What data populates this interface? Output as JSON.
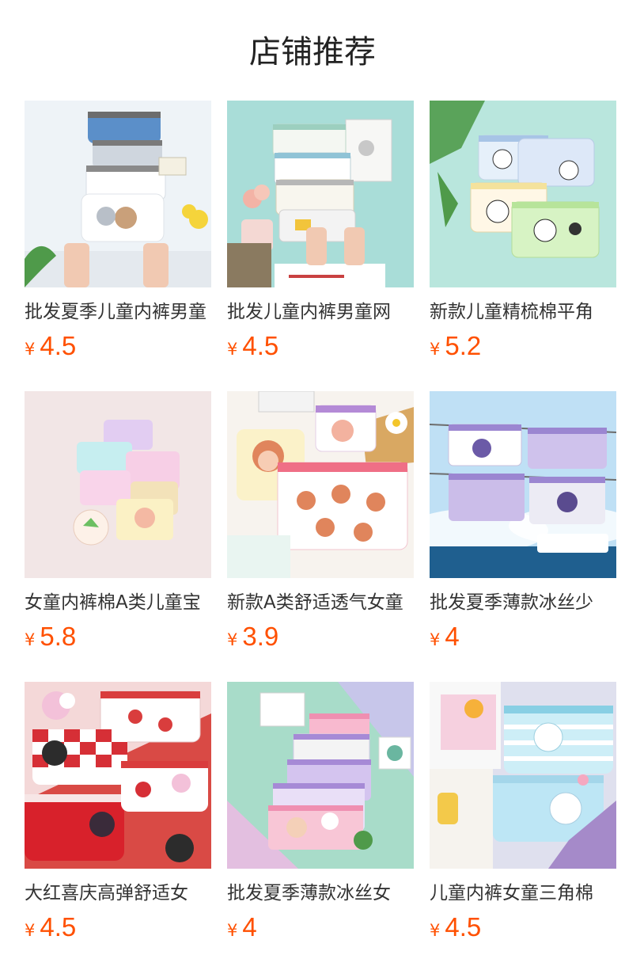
{
  "page": {
    "title": "店铺推荐"
  },
  "theme": {
    "price_color": "#ff5000",
    "title_color": "#222222",
    "text_color": "#333333"
  },
  "products": [
    {
      "name": "批发夏季儿童内裤男童",
      "currency": "¥",
      "price": "4.5",
      "image": "boys-boxer-briefs-cartoon-photo",
      "bg": "#eef3f7",
      "accent": "#5b8fc9"
    },
    {
      "name": "批发儿童内裤男童网",
      "currency": "¥",
      "price": "4.5",
      "image": "boys-mesh-underwear-photo",
      "bg": "#a9ddd8",
      "accent": "#ffffff"
    },
    {
      "name": "新款儿童精梳棉平角",
      "currency": "¥",
      "price": "5.2",
      "image": "panda-boxer-briefs-photo",
      "bg": "#b9e6dd",
      "accent": "#8fb7e8"
    },
    {
      "name": "女童内裤棉A类儿童宝",
      "currency": "¥",
      "price": "5.8",
      "image": "girls-pastel-underwear-photo",
      "bg": "#f2e6e6",
      "accent": "#e9a9d6"
    },
    {
      "name": "新款A类舒适透气女童",
      "currency": "¥",
      "price": "3.9",
      "image": "girls-character-underwear-photo",
      "bg": "#f7f3ee",
      "accent": "#f08aa0"
    },
    {
      "name": "批发夏季薄款冰丝少",
      "currency": "¥",
      "price": "4",
      "image": "ice-silk-boxer-photo",
      "bg": "#bfe0f5",
      "accent": "#9b86d1"
    },
    {
      "name": "大红喜庆高弹舒适女",
      "currency": "¥",
      "price": "4.5",
      "image": "red-festive-briefs-photo",
      "bg": "#d94a45",
      "accent": "#ffffff"
    },
    {
      "name": "批发夏季薄款冰丝女",
      "currency": "¥",
      "price": "4",
      "image": "girls-ice-silk-boxer-photo",
      "bg": "#a8dcc9",
      "accent": "#c9b6e8"
    },
    {
      "name": "儿童内裤女童三角棉",
      "currency": "¥",
      "price": "4.5",
      "image": "girls-cotton-briefs-photo",
      "bg": "#dfe0ee",
      "accent": "#9fd6ea"
    }
  ]
}
